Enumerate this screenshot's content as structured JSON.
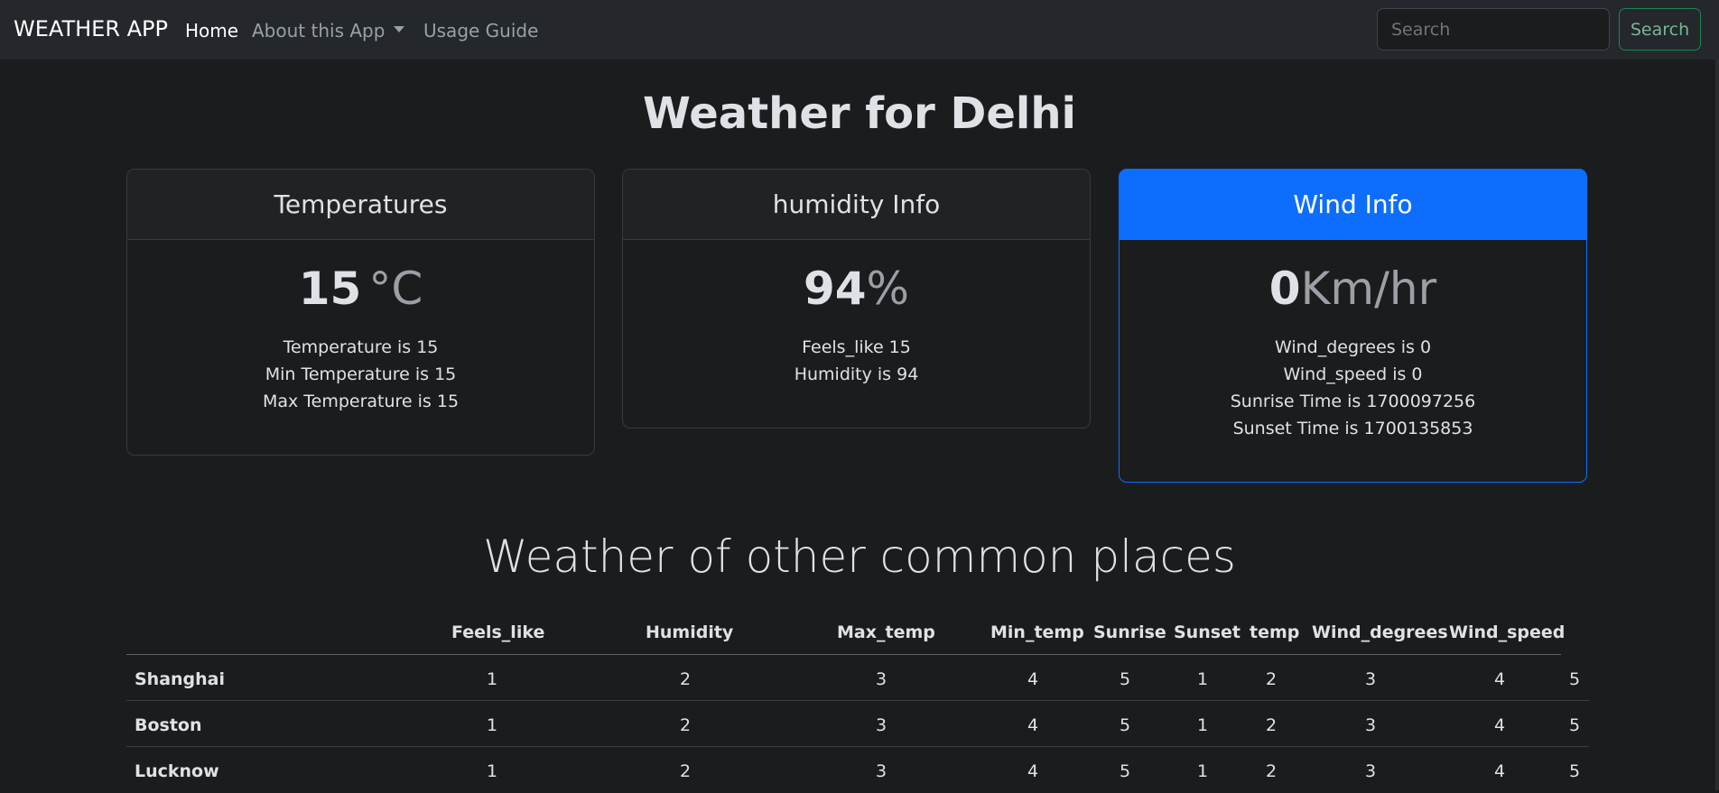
{
  "navbar": {
    "brand": "WEATHER APP",
    "links": [
      {
        "label": "Home",
        "active": true
      },
      {
        "label": "About this App",
        "active": false
      },
      {
        "label": "Usage Guide",
        "active": false
      }
    ],
    "search_placeholder": "Search",
    "search_button": "Search"
  },
  "title": "Weather for Delhi",
  "cards": {
    "temperature": {
      "header": "Temperatures",
      "value": "15",
      "unit": "°C",
      "lines": [
        "Temperature is 15",
        "Min Temperature is 15",
        "Max Temperature is 15"
      ]
    },
    "humidity": {
      "header": "humidity Info",
      "value": "94",
      "unit": "%",
      "lines": [
        "Feels_like 15",
        "Humidity is 94"
      ]
    },
    "wind": {
      "header": "Wind Info",
      "value": "0",
      "unit": "Km/hr",
      "lines": [
        "Wind_degrees is 0",
        "Wind_speed is 0",
        "Sunrise Time is 1700097256",
        "Sunset Time is 1700135853"
      ]
    }
  },
  "section_title": "Weather of other common places",
  "table": {
    "columns": [
      "Feels_like",
      "Humidity",
      "Max_temp",
      "Min_temp",
      "Sunrise",
      "Sunset",
      "temp",
      "Wind_degrees",
      "Wind_speed"
    ],
    "rows": [
      {
        "city": "Shanghai",
        "values": [
          "1",
          "2",
          "3",
          "4",
          "5",
          "1",
          "2",
          "3",
          "4",
          "5"
        ]
      },
      {
        "city": "Boston",
        "values": [
          "1",
          "2",
          "3",
          "4",
          "5",
          "1",
          "2",
          "3",
          "4",
          "5"
        ]
      },
      {
        "city": "Lucknow",
        "values": [
          "1",
          "2",
          "3",
          "4",
          "5",
          "1",
          "2",
          "3",
          "4",
          "5"
        ]
      }
    ]
  },
  "colors": {
    "background": "#1b1c1e",
    "navbar": "#24272b",
    "accent": "#0d6efd",
    "search_button": "#198754"
  }
}
